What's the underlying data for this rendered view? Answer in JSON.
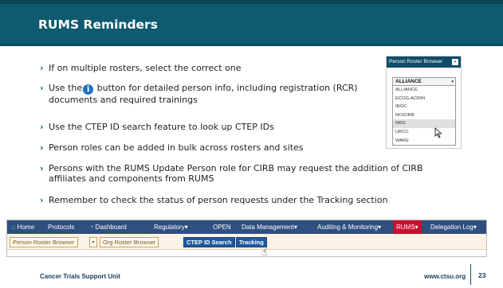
{
  "title": "RUMS Reminders",
  "bullets": [
    "If on multiple rosters, select the correct one",
    "button for detailed person info, including registration (RCR) documents and required trainings",
    "Use the CTEP ID search feature to look up CTEP IDs",
    "Person roles can be added in bulk across rosters and sites",
    "Persons with the RUMS Update Person role for CIRB may request the addition of CIRB affiliates and components from RUMS",
    "Remember to check the status of person requests under the Tracking section"
  ],
  "bullet_use_the": "Use the",
  "info_icon_glyph": "i",
  "roster": {
    "header": "Person Roster Browser",
    "selected": "ALLIANCE",
    "options": [
      "ALLIANCE",
      "ECOG-ACRIN",
      "IROC",
      "NCICIRB",
      "NRG",
      "URCC",
      "WAKE"
    ],
    "highlighted": "NRG"
  },
  "nav": {
    "items": [
      "Home",
      "Protocols",
      "Dashboard",
      "Regulatory",
      "OPEN",
      "Data Management",
      "Auditing & Monitoring",
      "RUMS",
      "Delegation Log"
    ],
    "active": "RUMS",
    "dropdown_caret": "▾"
  },
  "subnav": {
    "tabs": [
      "Person Roster Browser",
      "Org Roster Browser",
      "CTEP ID Search",
      "Tracking"
    ]
  },
  "footer": {
    "org": "Cancer Trials Support Unit",
    "url": "www.ctsu.org",
    "page": "23"
  },
  "colors": {
    "banner": "#0e5a6f",
    "nav_bar": "#2f4f80",
    "nav_active": "#c8102e",
    "tab_blue": "#1f5a9e"
  },
  "icons": [
    "chevron-right-icon",
    "info-icon",
    "home-icon",
    "dashboard-icon",
    "dropdown-caret-icon",
    "mouse-pointer-icon",
    "hand-cursor-icon"
  ]
}
